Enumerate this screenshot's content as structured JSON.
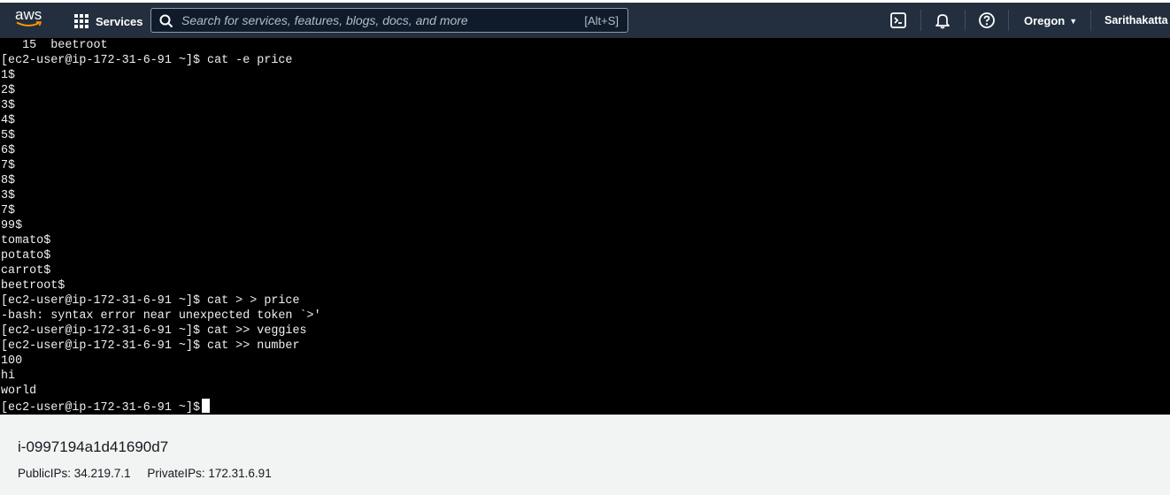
{
  "header": {
    "logo_text": "aws",
    "services_label": "Services",
    "search_placeholder": "Search for services, features, blogs, docs, and more",
    "search_shortcut": "[Alt+S]",
    "region": "Oregon",
    "user": "Sarithakatta",
    "icons": [
      "cloudshell-icon",
      "bell-icon",
      "help-icon"
    ]
  },
  "terminal": {
    "lines": [
      "   15  beetroot",
      "[ec2-user@ip-172-31-6-91 ~]$ cat -e price",
      "1$",
      "2$",
      "3$",
      "4$",
      "5$",
      "6$",
      "7$",
      "8$",
      "3$",
      "7$",
      "99$",
      "tomato$",
      "potato$",
      "carrot$",
      "beetroot$",
      "[ec2-user@ip-172-31-6-91 ~]$ cat > > price",
      "-bash: syntax error near unexpected token `>'",
      "[ec2-user@ip-172-31-6-91 ~]$ cat >> veggies",
      "[ec2-user@ip-172-31-6-91 ~]$ cat >> number",
      "100",
      "hi",
      "world"
    ],
    "prompt": "[ec2-user@ip-172-31-6-91 ~]$"
  },
  "instance": {
    "id": "i-0997194a1d41690d7",
    "public_ips": "PublicIPs: 34.219.7.1",
    "private_ips": "PrivateIPs: 172.31.6.91"
  },
  "colors": {
    "nav_bg": "#232f3e",
    "terminal_bg": "#000000",
    "terminal_fg": "#f0f0f0",
    "info_bg": "#f2f3f3"
  }
}
